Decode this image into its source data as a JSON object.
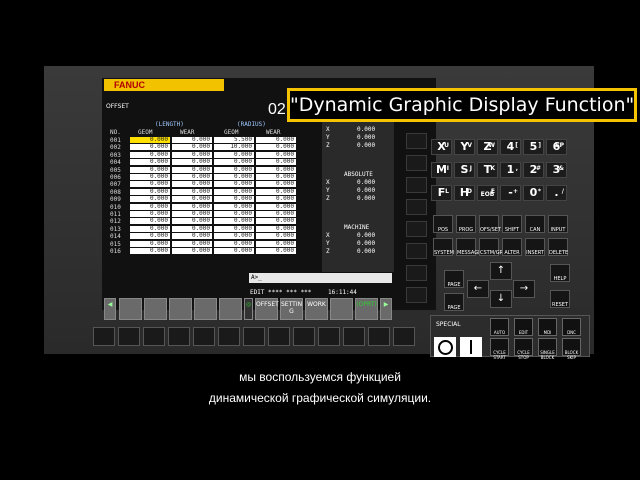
{
  "overlay_title": "\"Dynamic Graphic Display Function\"",
  "brand": "FANUC",
  "screen": {
    "title": "OFFSET",
    "offset_number": "02",
    "group_length": "(LENGTH)",
    "group_radius": "(RADIUS)",
    "columns": [
      "NO.",
      "GEOM",
      "WEAR",
      "GEOM",
      "WEAR"
    ],
    "rows": [
      {
        "no": "001",
        "v": [
          "0.000",
          "0.000",
          "5.500",
          "0.000"
        ]
      },
      {
        "no": "002",
        "v": [
          "0.000",
          "0.000",
          "10.000",
          "0.000"
        ]
      },
      {
        "no": "003",
        "v": [
          "0.000",
          "0.000",
          "0.000",
          "0.000"
        ]
      },
      {
        "no": "004",
        "v": [
          "0.000",
          "0.000",
          "0.000",
          "0.000"
        ]
      },
      {
        "no": "005",
        "v": [
          "0.000",
          "0.000",
          "0.000",
          "0.000"
        ]
      },
      {
        "no": "006",
        "v": [
          "0.000",
          "0.000",
          "0.000",
          "0.000"
        ]
      },
      {
        "no": "007",
        "v": [
          "0.000",
          "0.000",
          "0.000",
          "0.000"
        ]
      },
      {
        "no": "008",
        "v": [
          "0.000",
          "0.000",
          "0.000",
          "0.000"
        ]
      },
      {
        "no": "009",
        "v": [
          "0.000",
          "0.000",
          "0.000",
          "0.000"
        ]
      },
      {
        "no": "010",
        "v": [
          "0.000",
          "0.000",
          "0.000",
          "0.000"
        ]
      },
      {
        "no": "011",
        "v": [
          "0.000",
          "0.000",
          "0.000",
          "0.000"
        ]
      },
      {
        "no": "012",
        "v": [
          "0.000",
          "0.000",
          "0.000",
          "0.000"
        ]
      },
      {
        "no": "013",
        "v": [
          "0.000",
          "0.000",
          "0.000",
          "0.000"
        ]
      },
      {
        "no": "014",
        "v": [
          "0.000",
          "0.000",
          "0.000",
          "0.000"
        ]
      },
      {
        "no": "015",
        "v": [
          "0.000",
          "0.000",
          "0.000",
          "0.000"
        ]
      },
      {
        "no": "016",
        "v": [
          "0.000",
          "0.000",
          "0.000",
          "0.000"
        ]
      }
    ],
    "relative": {
      "x": "0.000",
      "y": "0.000",
      "z": "0.000"
    },
    "absolute_label": "ABSOLUTE",
    "absolute": {
      "x": "0.000",
      "y": "0.000",
      "z": "0.000"
    },
    "machine_label": "MACHINE",
    "machine": {
      "x": "0.000",
      "y": "0.000",
      "z": "0.000"
    },
    "axis_labels": [
      "X",
      "Y",
      "Z"
    ],
    "input_prompt": "A>_",
    "status_mode": "EDIT **** *** ***",
    "status_time": "16:11:44",
    "softkeys": [
      "OFFSET",
      "SETTIN G",
      "WORK",
      "(OPRT)"
    ]
  },
  "keypad": {
    "address_keys": [
      {
        "main": "X",
        "sub": "U"
      },
      {
        "main": "Y",
        "sub": "V"
      },
      {
        "main": "Z",
        "sub": "W"
      },
      {
        "main": "4",
        "sub": "["
      },
      {
        "main": "5",
        "sub": "]"
      },
      {
        "main": "6",
        "sub": "SP"
      },
      {
        "main": "M",
        "sub": "I"
      },
      {
        "main": "S",
        "sub": "J"
      },
      {
        "main": "T",
        "sub": "K"
      },
      {
        "main": "1",
        "sub": ","
      },
      {
        "main": "2",
        "sub": "#"
      },
      {
        "main": "3",
        "sub": "&"
      },
      {
        "main": "F",
        "sub": "L"
      },
      {
        "main": "H",
        "sub": "D"
      },
      {
        "main": "EOB",
        "sub": "E"
      },
      {
        "main": "-",
        "sub": "+"
      },
      {
        "main": "0",
        "sub": "*"
      },
      {
        "main": ".",
        "sub": "/"
      }
    ],
    "function_keys": [
      "POS",
      "PROG",
      "OFS/SET",
      "SHIFT",
      "CAN",
      "INPUT",
      "SYSTEM",
      "MESSAGE",
      "CSTM/GR",
      "ALTER",
      "INSERT",
      "DELETE"
    ],
    "page_up": "PAGE",
    "page_down": "PAGE",
    "help": "HELP",
    "reset": "RESET"
  },
  "special_panel": {
    "label": "SPECIAL",
    "buttons": [
      "AUTO",
      "EDIT",
      "MDI",
      "DNC",
      "CYCLE START",
      "CYCLE STOP",
      "SINGLE BLOCK",
      "BLOCK SKIP"
    ]
  },
  "caption": {
    "line1": "мы воспользуемся функцией",
    "line2": "динамической графической симуляции."
  }
}
